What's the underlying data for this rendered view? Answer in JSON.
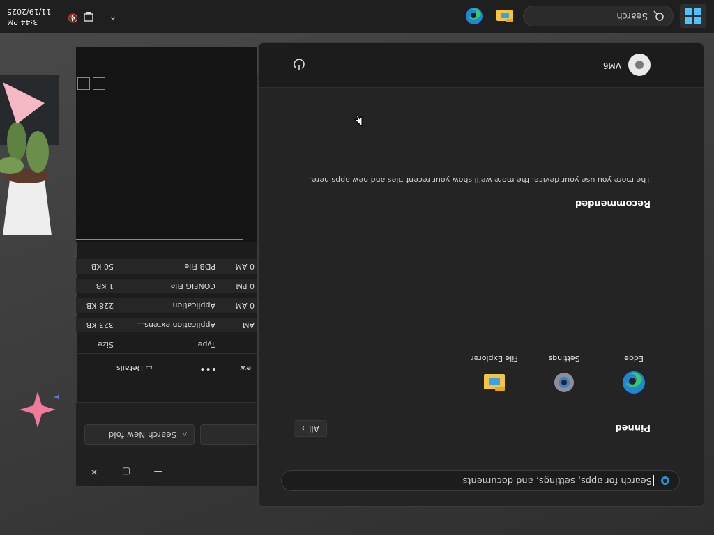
{
  "taskbar": {
    "search_label": "Search",
    "clock_time": "3:44 PM",
    "clock_date": "11/19/2025",
    "icons": [
      "windows-start-icon",
      "search-icon",
      "file-explorer-icon",
      "edge-icon",
      "chevron-up-icon",
      "network-icon",
      "volume-icon"
    ]
  },
  "start_menu": {
    "search_placeholder": "Search for apps, settings, and documents",
    "pinned_title": "Pinned",
    "all_button": "All",
    "pinned_apps": [
      {
        "label": "Edge",
        "icon": "edge-icon"
      },
      {
        "label": "Settings",
        "icon": "settings-gear-icon"
      },
      {
        "label": "File Explorer",
        "icon": "file-explorer-icon"
      }
    ],
    "recommended_title": "Recommended",
    "recommended_text": "The more you use your device, the more we'll show your recent files and new apps here.",
    "user_name": "VM6",
    "power_icon": "power-icon"
  },
  "explorer": {
    "search_placeholder": "Search New fold",
    "view_label": "iew",
    "more_label": "•••",
    "details_label": "Details",
    "columns": [
      "Type",
      "Size"
    ],
    "rows": [
      {
        "date": "AM",
        "type": "Application extens...",
        "size": "323 KB"
      },
      {
        "date": "0 AM",
        "type": "Application",
        "size": "228 KB"
      },
      {
        "date": "0 PM",
        "type": "CONFIG File",
        "size": "1 KB"
      },
      {
        "date": "0 AM",
        "type": "PDB File",
        "size": "50 KB"
      }
    ]
  },
  "colors": {
    "accent": "#4cc2ff",
    "start_bg": "#242424",
    "taskbar_bg": "#1f1f1f"
  }
}
